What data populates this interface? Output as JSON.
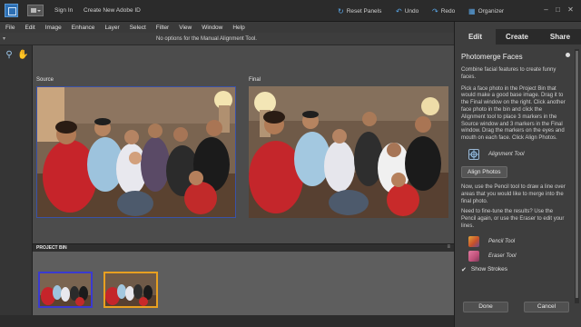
{
  "topbar": {
    "sign_in": "Sign In",
    "create_id": "Create New Adobe ID",
    "reset_panels": "Reset Panels",
    "undo": "Undo",
    "redo": "Redo",
    "organizer": "Organizer"
  },
  "menu": [
    "File",
    "Edit",
    "Image",
    "Enhance",
    "Layer",
    "Select",
    "Filter",
    "View",
    "Window",
    "Help"
  ],
  "options_bar": {
    "message": "No options for the Manual Alignment Tool."
  },
  "workspace": {
    "source_label": "Source",
    "final_label": "Final"
  },
  "project_bin": {
    "title": "PROJECT BIN"
  },
  "panel": {
    "tabs": [
      "Edit",
      "Create",
      "Share"
    ],
    "title": "Photomerge Faces",
    "intro": "Combine facial features to create funny faces.",
    "instructions": "Pick a face photo in the Project Bin that would make a good base image. Drag it to the Final window on the right. Click another face photo in the bin and click the Alignment tool to place 3 markers in the Source window and 3 markers in the Final window. Drag the markers on the eyes and mouth on each face. Click Align Photos.",
    "alignment_tool": "Alignment Tool",
    "align_button": "Align Photos",
    "pencil_text": "Now, use the Pencil tool to draw a line over areas that you would like to merge into the final photo.",
    "finetune_text": "Need to fine-tune the results? Use the Pencil again, or use the Eraser to edit your lines.",
    "pencil_tool": "Pencil Tool",
    "eraser_tool": "Eraser Tool",
    "show_strokes": "Show Strokes",
    "done": "Done",
    "cancel": "Cancel"
  },
  "colors": {
    "accent_blue": "#5aa7e8",
    "panel_bg": "#3e3e3e",
    "thumb_selected": "#e8a020",
    "thumb_source": "#3a3ad0"
  }
}
